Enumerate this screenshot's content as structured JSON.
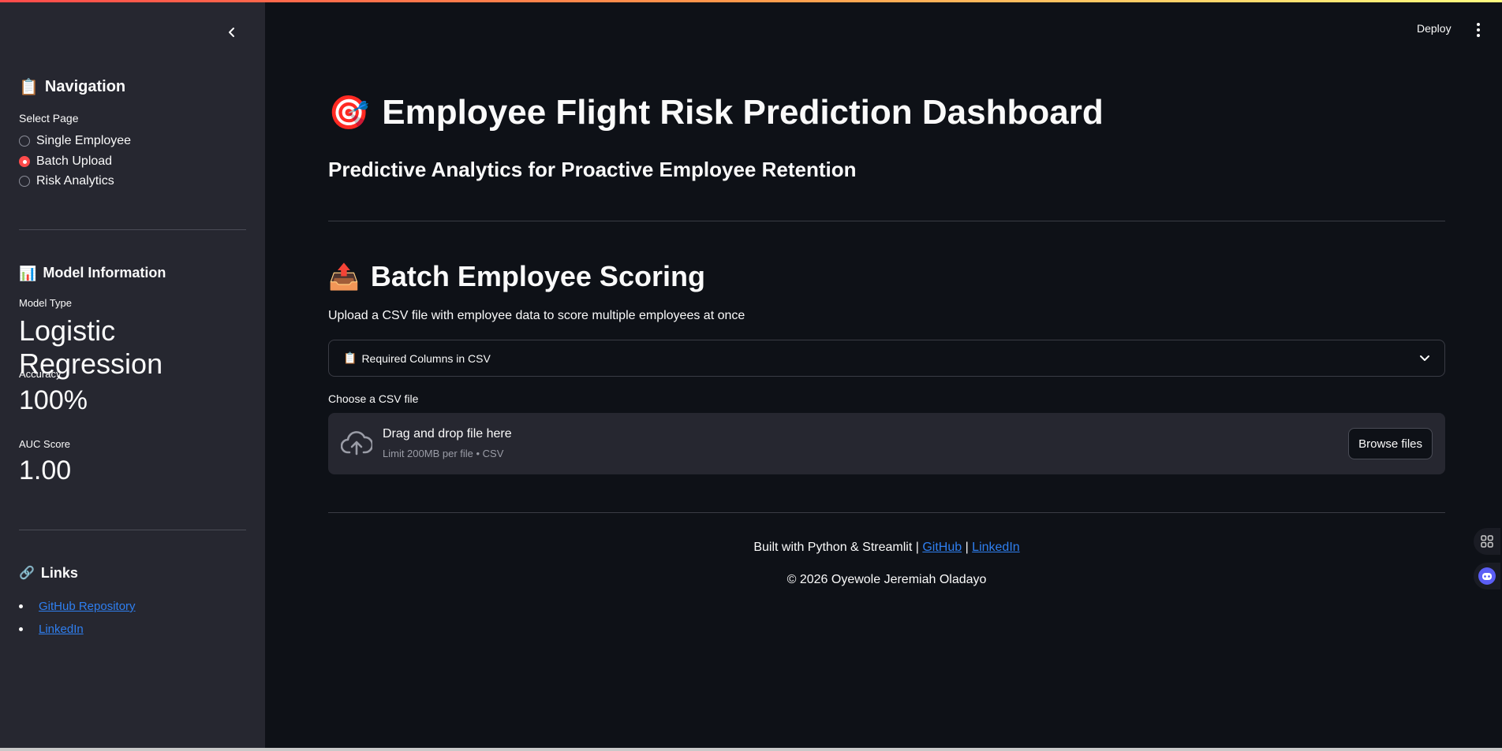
{
  "sidebar": {
    "navigation_heading": "Navigation",
    "navigation_emoji": "📋",
    "select_page_label": "Select Page",
    "pages": [
      {
        "label": "Single Employee",
        "selected": false
      },
      {
        "label": "Batch Upload",
        "selected": true
      },
      {
        "label": "Risk Analytics",
        "selected": false
      }
    ],
    "model_info_heading": "Model Information",
    "model_info_emoji": "📊",
    "model_type_label": "Model Type",
    "model_type_value": "Logistic Regression",
    "accuracy_label": "Accuracy",
    "accuracy_value": "100%",
    "auc_label": "AUC Score",
    "auc_value": "1.00",
    "links_heading": "Links",
    "links_emoji": "🔗",
    "links": [
      {
        "label": "GitHub Repository"
      },
      {
        "label": "LinkedIn"
      }
    ]
  },
  "toolbar": {
    "deploy_label": "Deploy"
  },
  "main": {
    "title_emoji": "🎯",
    "title": "Employee Flight Risk Prediction Dashboard",
    "subtitle": "Predictive Analytics for Proactive Employee Retention",
    "section_emoji": "📤",
    "section_title": "Batch Employee Scoring",
    "section_desc": "Upload a CSV file with employee data to score multiple employees at once",
    "expander_emoji": "📋",
    "expander_label": "Required Columns in CSV",
    "file_label": "Choose a CSV file",
    "dropzone_main": "Drag and drop file here",
    "dropzone_sub": "Limit 200MB per file • CSV",
    "browse_label": "Browse files"
  },
  "footer": {
    "built_with": "Built with Python & Streamlit | ",
    "github_link": "GitHub",
    "separator": " | ",
    "linkedin_link": "LinkedIn",
    "copyright": "© 2026 Oyewole Jeremiah Oladayo"
  },
  "colors": {
    "accent": "#ff4b4b",
    "link": "#2f7ff0",
    "background": "#0e1117",
    "sidebar": "#262730"
  }
}
